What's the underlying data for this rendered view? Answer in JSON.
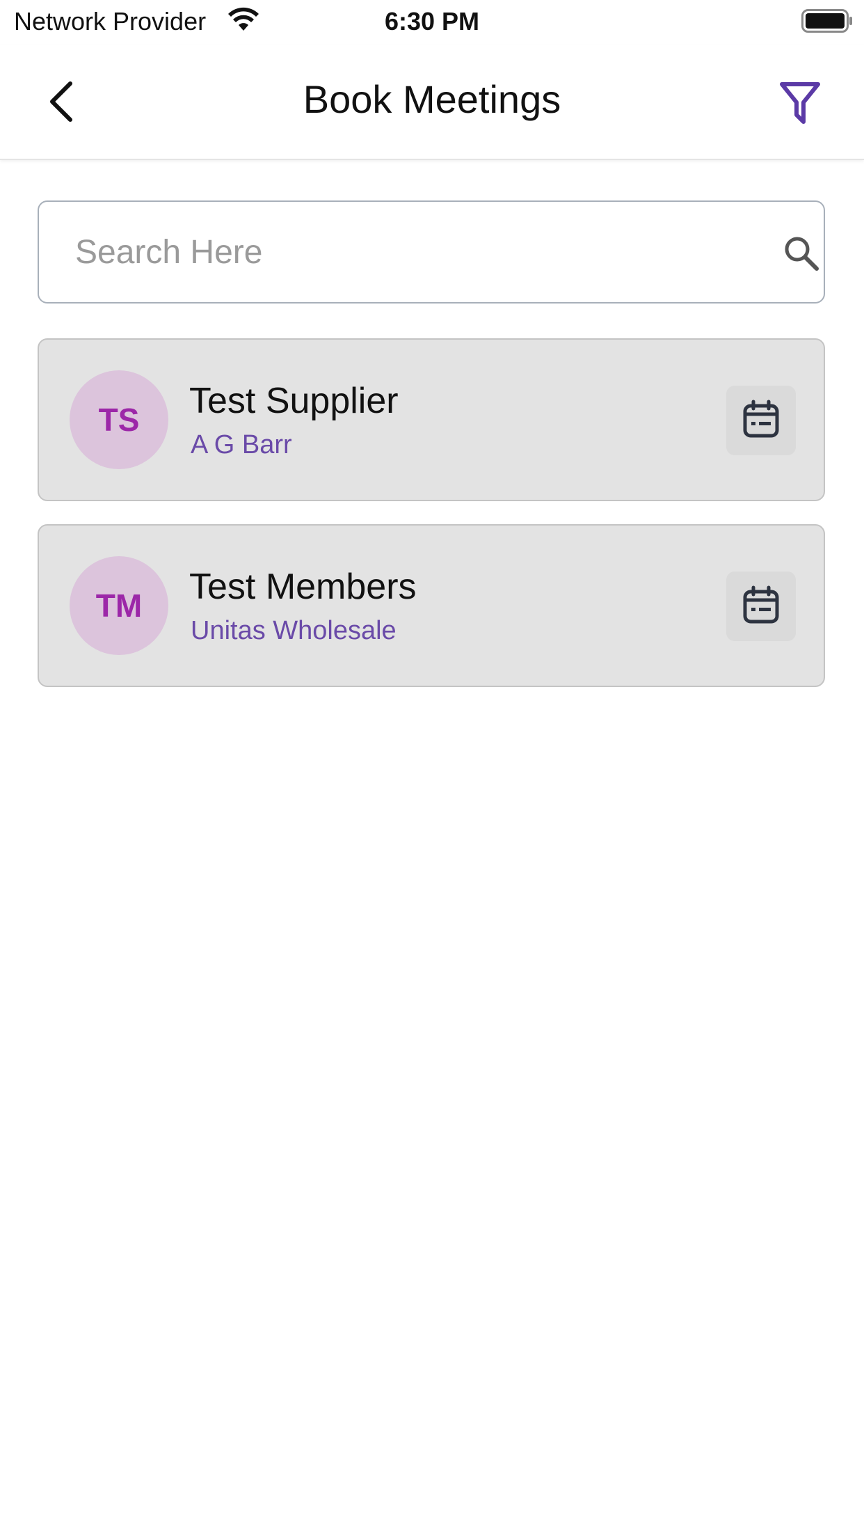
{
  "status_bar": {
    "carrier": "Network Provider",
    "time": "6:30 PM"
  },
  "nav": {
    "title": "Book Meetings",
    "back_icon": "chevron-left-icon",
    "filter_icon": "filter-icon"
  },
  "search": {
    "placeholder": "Search Here",
    "value": ""
  },
  "items": [
    {
      "initials": "TS",
      "name": "Test Supplier",
      "subtitle": "A G Barr"
    },
    {
      "initials": "TM",
      "name": "Test Members",
      "subtitle": "Unitas Wholesale"
    }
  ],
  "colors": {
    "accent": "#5b3aa6",
    "avatar_text": "#9c27a8",
    "avatar_bg": "#dcc4dc",
    "subtitle": "#6a4aa8",
    "card_bg": "#e3e3e3"
  }
}
